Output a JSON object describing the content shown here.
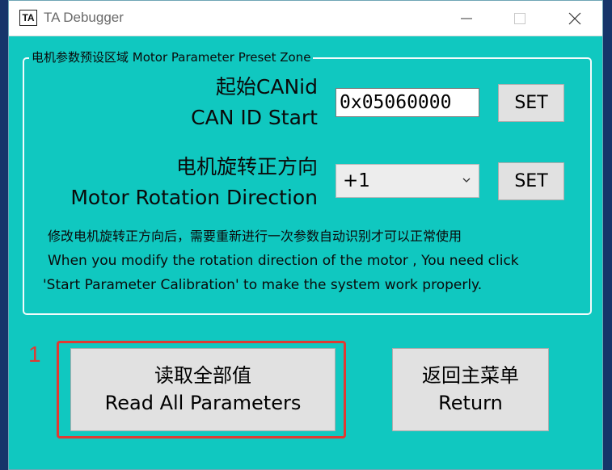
{
  "titlebar": {
    "icon_text": "TA",
    "title": "TA Debugger"
  },
  "group": {
    "legend": "电机参数预设区域 Motor Parameter Preset Zone"
  },
  "can_id": {
    "label_cn": "起始CANid",
    "label_en": "CAN ID Start",
    "value": "0x05060000",
    "set_label": "SET"
  },
  "direction": {
    "label_cn": "电机旋转正方向",
    "label_en": "Motor Rotation Direction",
    "selected": "+1",
    "set_label": "SET"
  },
  "note": {
    "cn": "修改电机旋转正方向后，需要重新进行一次参数自动识别才可以正常使用",
    "en_line1": "When you modify the rotation direction of the motor , You need click",
    "en_line2": "'Start Parameter Calibration' to make the system work properly."
  },
  "read_all": {
    "label_cn": "读取全部值",
    "label_en": "Read All Parameters"
  },
  "return_btn": {
    "label_cn": "返回主菜单",
    "label_en": "Return"
  },
  "annotation": {
    "step_number": "1"
  },
  "colors": {
    "window_background": "#10c8c0",
    "highlight": "#e03a32",
    "button": "#e1e1e1"
  }
}
